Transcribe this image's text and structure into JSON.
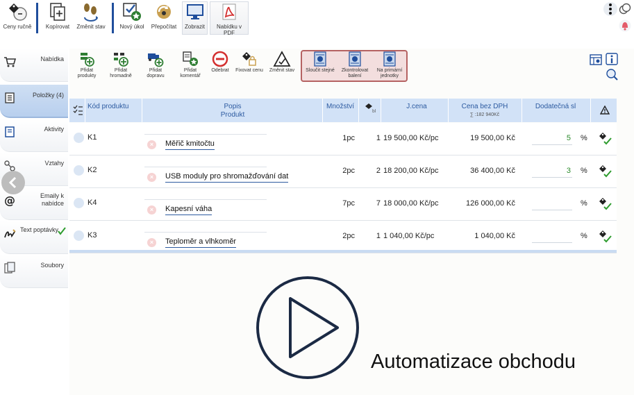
{
  "toolbar": {
    "buttons": [
      {
        "label": "Ceny ručně",
        "icon": "price-tag-gear-icon"
      },
      {
        "label": "Kopírovat",
        "icon": "copy-document-icon"
      },
      {
        "label": "Změnit stav",
        "icon": "footsteps-icon"
      },
      {
        "label": "Nový úkol",
        "icon": "task-check-icon"
      },
      {
        "label": "Přepočítat",
        "icon": "recalculate-icon"
      },
      {
        "label": "Zobrazit",
        "icon": "monitor-icon"
      },
      {
        "label": "Nabídku v PDF",
        "icon": "pdf-icon"
      }
    ]
  },
  "sidebar": {
    "items": [
      {
        "label": "Nabídka",
        "icon": "cart-icon"
      },
      {
        "label": "Položky (4)",
        "icon": "list-document-icon"
      },
      {
        "label": "Aktivity",
        "icon": "activity-book-icon"
      },
      {
        "label": "Vztahy",
        "icon": "link-icon"
      },
      {
        "label": "Emaily k nabídce",
        "icon": "email-at-icon"
      },
      {
        "label": "Text poptávky",
        "icon": "signature-icon"
      },
      {
        "label": "Soubory",
        "icon": "files-icon"
      }
    ]
  },
  "subtoolbar": {
    "buttons": [
      {
        "label": "Přidat produkty"
      },
      {
        "label": "Přidat hromadně"
      },
      {
        "label": "Přidat dopravu"
      },
      {
        "label": "Přidat komentář"
      },
      {
        "label": "Odebrat"
      },
      {
        "label": "Fixovat cenu"
      },
      {
        "label": "Změnit stav"
      },
      {
        "label": "Sloučit stejné"
      },
      {
        "label": "Zkontrolovat balení"
      },
      {
        "label": "Na primární jednotky"
      }
    ]
  },
  "table": {
    "headers": {
      "code": "Kód produktu",
      "desc_line1": "Popis",
      "desc_line2": "Produkt",
      "qty": "Množství",
      "unit_price": "J.cena",
      "total": "Cena bez DPH",
      "total_sum": "∑ :182 940Kč",
      "discount": "Dodatečná sl"
    },
    "rows": [
      {
        "code": "K1",
        "desc": "Měřič kmitočtu",
        "qty": "1pc",
        "count": "1",
        "price": "19 500,00 Kč/pc",
        "total": "19 500,00 Kč",
        "discount": "5",
        "pct": "%"
      },
      {
        "code": "K2",
        "desc": "USB moduly pro shromažďování dat",
        "qty": "2pc",
        "count": "2",
        "price": "18 200,00 Kč/pc",
        "total": "36 400,00 Kč",
        "discount": "3",
        "pct": "%"
      },
      {
        "code": "K4",
        "desc": "Kapesní váha",
        "qty": "7pc",
        "count": "7",
        "price": "18 000,00 Kč/pc",
        "total": "126 000,00 Kč",
        "discount": "",
        "pct": "%"
      },
      {
        "code": "K3",
        "desc": "Teploměr a vlhkoměr",
        "qty": "2pc",
        "count": "1",
        "price": "1 040,00 Kč/pc",
        "total": "1 040,00 Kč",
        "discount": "",
        "pct": "%"
      }
    ]
  },
  "overlay": {
    "text": "Automatizace obchodu"
  },
  "colors": {
    "accent": "#1f4e9c",
    "header_bg": "#d2e2f7",
    "active_tab": "#c4d7f1",
    "discount_green": "#2b8a2b"
  }
}
